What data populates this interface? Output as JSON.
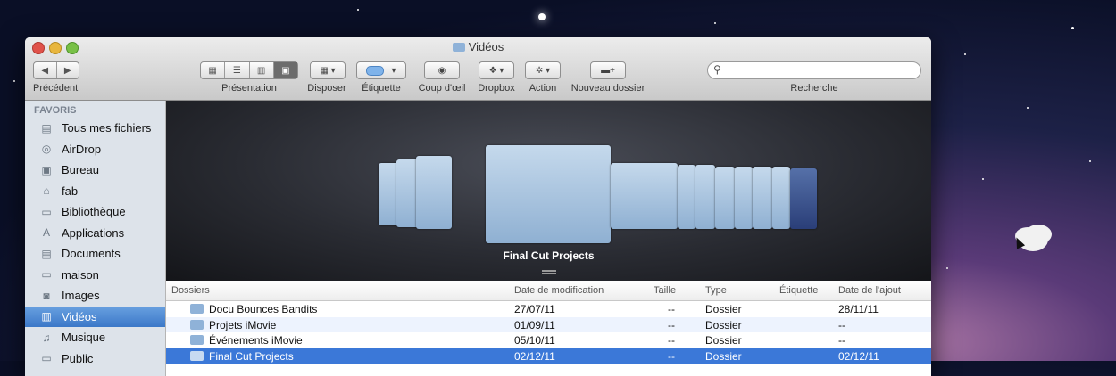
{
  "window": {
    "title": "Vidéos"
  },
  "toolbar": {
    "back_label": "Précédent",
    "view_label": "Présentation",
    "arrange_label": "Disposer",
    "label_label": "Étiquette",
    "quicklook_label": "Coup d'œil",
    "dropbox_label": "Dropbox",
    "action_label": "Action",
    "new_folder_label": "Nouveau dossier",
    "search_label": "Recherche",
    "search_value": ""
  },
  "sidebar": {
    "heading": "FAVORIS",
    "items": [
      {
        "label": "Tous mes fichiers",
        "icon": "all-files-icon"
      },
      {
        "label": "AirDrop",
        "icon": "airdrop-icon"
      },
      {
        "label": "Bureau",
        "icon": "desktop-icon"
      },
      {
        "label": "fab",
        "icon": "home-icon"
      },
      {
        "label": "Bibliothèque",
        "icon": "folder-icon"
      },
      {
        "label": "Applications",
        "icon": "applications-icon"
      },
      {
        "label": "Documents",
        "icon": "documents-icon"
      },
      {
        "label": "maison",
        "icon": "folder-icon"
      },
      {
        "label": "Images",
        "icon": "camera-icon"
      },
      {
        "label": "Vidéos",
        "icon": "film-icon",
        "selected": true
      },
      {
        "label": "Musique",
        "icon": "music-icon"
      },
      {
        "label": "Public",
        "icon": "public-icon"
      }
    ]
  },
  "coverflow": {
    "caption": "Final Cut Projects"
  },
  "list": {
    "headers": {
      "name": "Dossiers",
      "modified": "Date de modification",
      "size": "Taille",
      "kind": "Type",
      "tag": "Étiquette",
      "added": "Date de l'ajout"
    },
    "rows": [
      {
        "name": "Docu Bounces Bandits",
        "modified": "27/07/11",
        "size": "--",
        "kind": "Dossier",
        "added": "28/11/11"
      },
      {
        "name": "Projets iMovie",
        "modified": "01/09/11",
        "size": "--",
        "kind": "Dossier",
        "added": "--"
      },
      {
        "name": "Événements iMovie",
        "modified": "05/10/11",
        "size": "--",
        "kind": "Dossier",
        "added": "--"
      },
      {
        "name": "Final Cut Projects",
        "modified": "02/12/11",
        "size": "--",
        "kind": "Dossier",
        "added": "02/12/11",
        "selected": true
      }
    ]
  },
  "colors": {
    "selection": "#3b78d8",
    "sidebar_bg": "#dde3ea",
    "folder": "#8fb2d8"
  }
}
